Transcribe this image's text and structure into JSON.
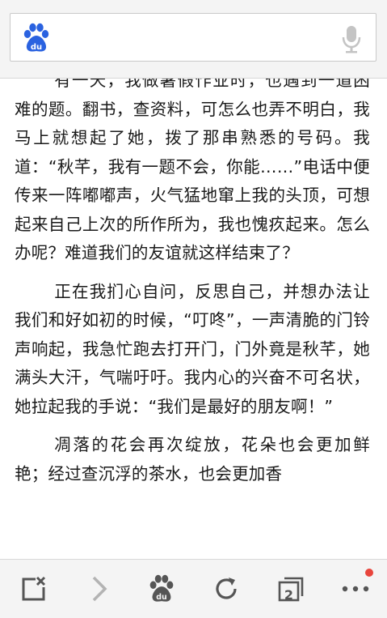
{
  "search": {
    "placeholder": "",
    "value": "",
    "logo_icon": "baidu-paw-logo-icon",
    "mic_icon": "microphone-icon"
  },
  "article": {
    "paragraphs": [
      "有一天，我做暑假作业时，也遇到一道困难的题。翻书，查资料，可怎么也弄不明白，我马上就想起了她，拨了那串熟悉的号码。我道：“秋芊，我有一题不会，你能……”电话中便传来一阵嘟嘟声，火气猛地窜上我的头顶，可想起来自己上次的所作所为，我也愧疚起来。怎么办呢？难道我们的友谊就这样结束了？",
      "正在我扪心自问，反思自己，并想办法让我们和好如初的时候，“叮咚”，一声清脆的门铃声响起，我急忙跑去打开门，门外竟是秋芊，她满头大汗，气喘吁吁。我内心的兴奋不可名状，她拉起我的手说：“我们是最好的朋友啊！”",
      "凋落的花会再次绽放，花朵也会更加鲜艳；经过查沉浮的茶水，也会更加香"
    ]
  },
  "toolbar": {
    "tabs_count": "2",
    "icons": [
      "close-page-icon",
      "forward-arrow-icon",
      "baidu-paw-home-icon",
      "refresh-icon",
      "tabs-icon",
      "more-menu-icon"
    ],
    "notification_color": "#e8453c"
  }
}
